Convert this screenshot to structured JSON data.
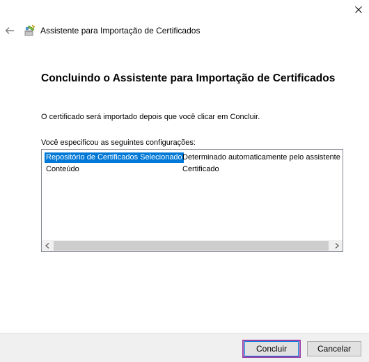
{
  "window": {
    "title": "Assistente para Importação de Certificados"
  },
  "main": {
    "heading": "Concluindo o Assistente para Importação de Certificados",
    "info_text": "O certificado será importado depois que você clicar em Concluir.",
    "config_label": "Você especificou as seguintes configurações:",
    "settings": [
      {
        "name": "Repositório de Certificados Selecionado",
        "value": "Determinado automaticamente pelo assistente",
        "selected": true
      },
      {
        "name": "Conteúdo",
        "value": "Certificado",
        "selected": false
      }
    ]
  },
  "footer": {
    "finish_label": "Concluir",
    "cancel_label": "Cancelar"
  },
  "colors": {
    "selection": "#0078d7",
    "highlight_border": "#9b3fa6",
    "footer_bg": "#f0f0f0"
  },
  "icons": {
    "close": "close-icon",
    "back": "back-arrow-icon",
    "wizard": "certificate-wizard-icon",
    "scroll_left": "chevron-left-icon",
    "scroll_right": "chevron-right-icon"
  }
}
